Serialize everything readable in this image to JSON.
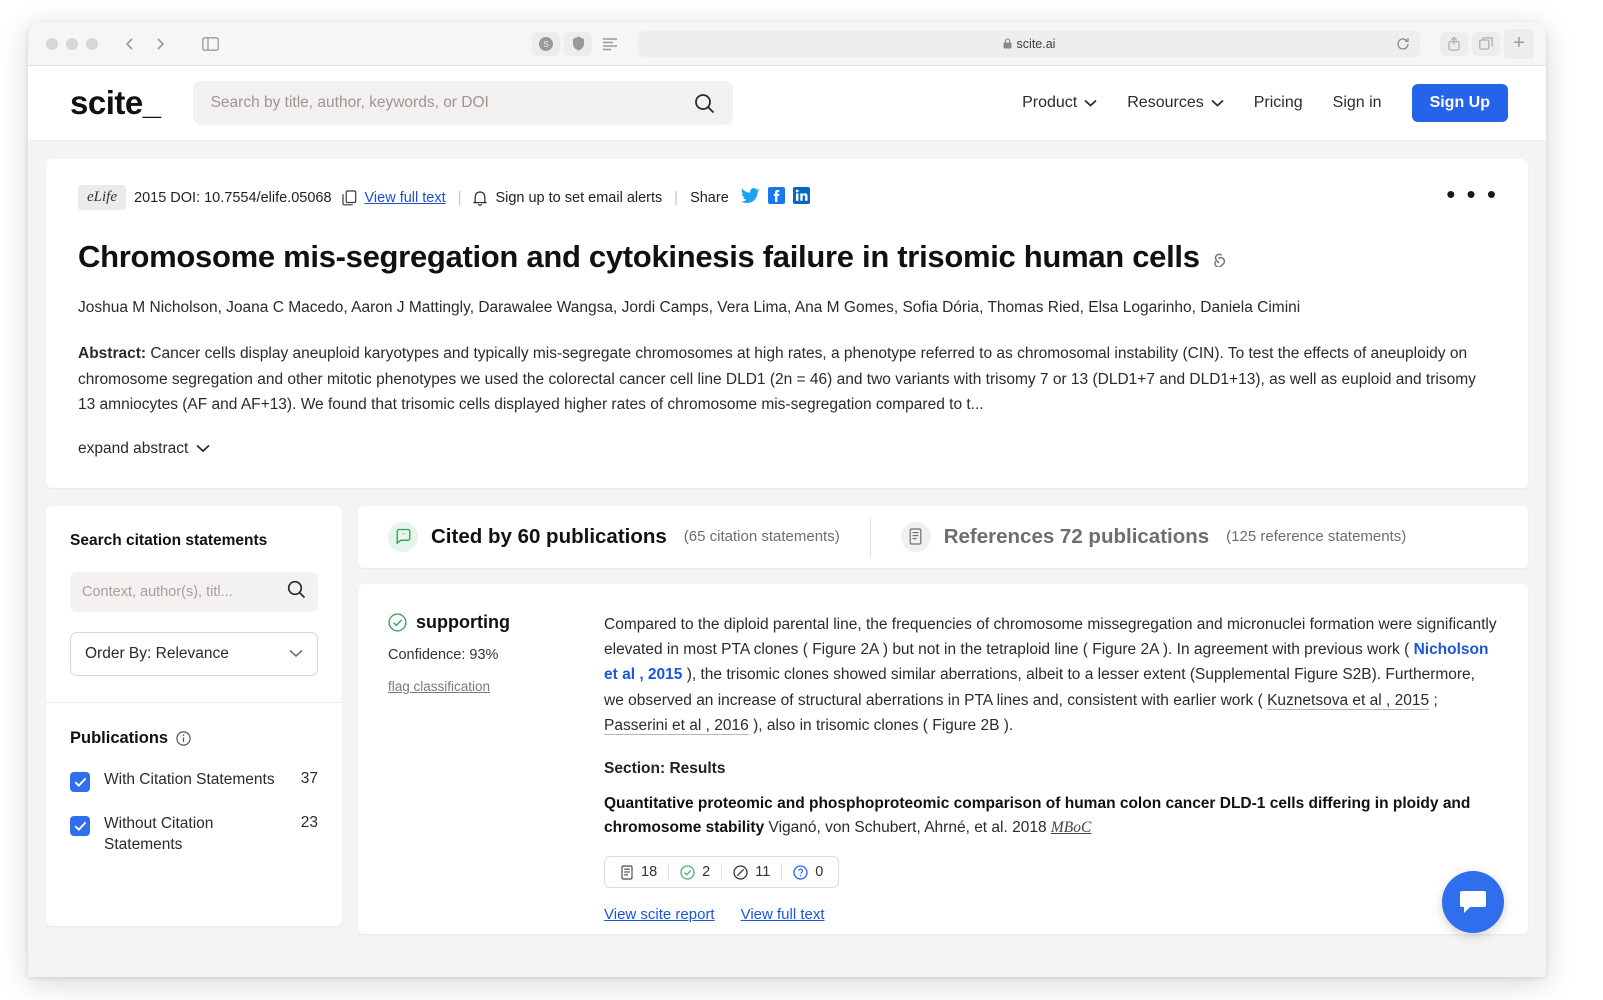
{
  "browser": {
    "url": "scite.ai",
    "lock_icon": "lock-icon",
    "back_icon": "chevron-left-icon",
    "forward_icon": "chevron-right-icon",
    "sidebar_icon": "sidebar-toggle-icon",
    "shield_icon": "shield-icon",
    "reader_icon": "reader-view-icon",
    "reload_icon": "reload-icon",
    "share_icon": "share-icon",
    "tabs_icon": "tab-overview-icon",
    "new_tab_label": "+"
  },
  "header": {
    "logo": "scite_",
    "search": {
      "placeholder": "Search by title, author, keywords, or DOI",
      "value": "",
      "icon": "search-icon"
    },
    "nav": [
      {
        "label": "Product",
        "has_caret": true
      },
      {
        "label": "Resources",
        "has_caret": true
      },
      {
        "label": "Pricing",
        "has_caret": false
      },
      {
        "label": "Sign in",
        "has_caret": false
      }
    ],
    "signup_label": "Sign Up",
    "accent_color": "#2563eb"
  },
  "paper": {
    "journal": "eLife",
    "doi_line": "2015 DOI: 10.7554/elife.05068",
    "copy_icon": "copy-icon",
    "view_full_text": "View full text",
    "sep1": "|",
    "bell_icon": "bell-icon",
    "email_alerts": "Sign up to set email alerts",
    "sep2": "|",
    "share_label": "Share",
    "social": [
      "twitter-icon",
      "facebook-icon",
      "linkedin-icon"
    ],
    "kebab": "• • •",
    "title": "Chromosome mis-segregation and cytokinesis failure in trisomic human cells",
    "title_link_icon": "link-icon",
    "authors": "Joshua M Nicholson, Joana C Macedo, Aaron J Mattingly, Darawalee Wangsa, Jordi Camps, Vera Lima, Ana M Gomes, Sofia Dória, Thomas Ried, Elsa Logarinho, Daniela Cimini",
    "abstract_label": "Abstract:",
    "abstract_text": " Cancer cells display aneuploid karyotypes and typically mis-segregate chromosomes at high rates, a phenotype referred to as chromosomal instability (CIN). To test the effects of aneuploidy on chromosome segregation and other mitotic phenotypes we used the colorectal cancer cell line DLD1 (2n = 46) and two variants with trisomy 7 or 13 (DLD1+7 and DLD1+13), as well as euploid and trisomy 13 amniocytes (AF and AF+13). We found that trisomic cells displayed higher rates of chromosome mis-segregation compared to t...",
    "expand_label": "expand abstract"
  },
  "sidebar": {
    "search_title": "Search citation statements",
    "search_placeholder": "Context, author(s), titl...",
    "search_value": "",
    "search_icon": "search-icon",
    "order_by": "Order By: Relevance",
    "order_caret": "chevron-down-icon",
    "publications_title": "Publications",
    "info_icon": "info-icon",
    "filters": [
      {
        "label": "With Citation Statements",
        "count": "37",
        "checked": true
      },
      {
        "label": "Without Citation Statements",
        "count": "23",
        "checked": true
      }
    ],
    "checkbox_color": "#2f6fed"
  },
  "tabs": [
    {
      "label": "Cited by 60 publications",
      "sub": "(65 citation statements)",
      "icon": "quote-bubble-icon",
      "active": true
    },
    {
      "label": "References 72 publications",
      "sub": "(125 reference statements)",
      "icon": "document-icon",
      "active": false
    }
  ],
  "statement": {
    "classification": "supporting",
    "classification_icon": "check-circle-icon",
    "classification_color": "#3aa35f",
    "confidence": "Confidence: 93%",
    "flag_link": "flag classification",
    "text_part1": "Compared to the diploid parental line, the frequencies of chromosome missegregation and micronuclei formation were significantly elevated in most PTA clones ( Figure 2A ) but not in the tetraploid line ( Figure 2A ). In agreement with previous work ( ",
    "citation_link": "Nicholson et al , 2015",
    "text_part2": " ), the trisomic clones showed similar aberrations, albeit to a lesser extent (Supplemental Figure S2B). Furthermore, we observed an increase of structural aberrations in PTA lines and, consistent with earlier work ( ",
    "ref2": "Kuznetsova et al , 2015",
    "text_sep": " ; ",
    "ref3": "Passerini et al , 2016",
    "text_part3": " ), also in trisomic clones ( Figure 2B ).",
    "section": "Section: Results",
    "pub_title_bold": "Quantitative proteomic and phosphoproteomic comparison of human colon cancer DLD-1 cells differing in ploidy and chromosome stability",
    "pub_authors": " Viganó, von Schubert, Ahrné, et al. 2018 ",
    "pub_journal": "MBoC",
    "metrics": [
      {
        "icon": "document-icon",
        "value": "18"
      },
      {
        "icon": "supporting-check-icon",
        "value": "2"
      },
      {
        "icon": "mentioning-icon",
        "value": "11"
      },
      {
        "icon": "contrasting-question-icon",
        "value": "0"
      }
    ],
    "links": [
      {
        "label": "View scite report"
      },
      {
        "label": "View full text"
      }
    ]
  },
  "chat": {
    "icon": "chat-bubble-icon",
    "color": "#2f6fed"
  }
}
